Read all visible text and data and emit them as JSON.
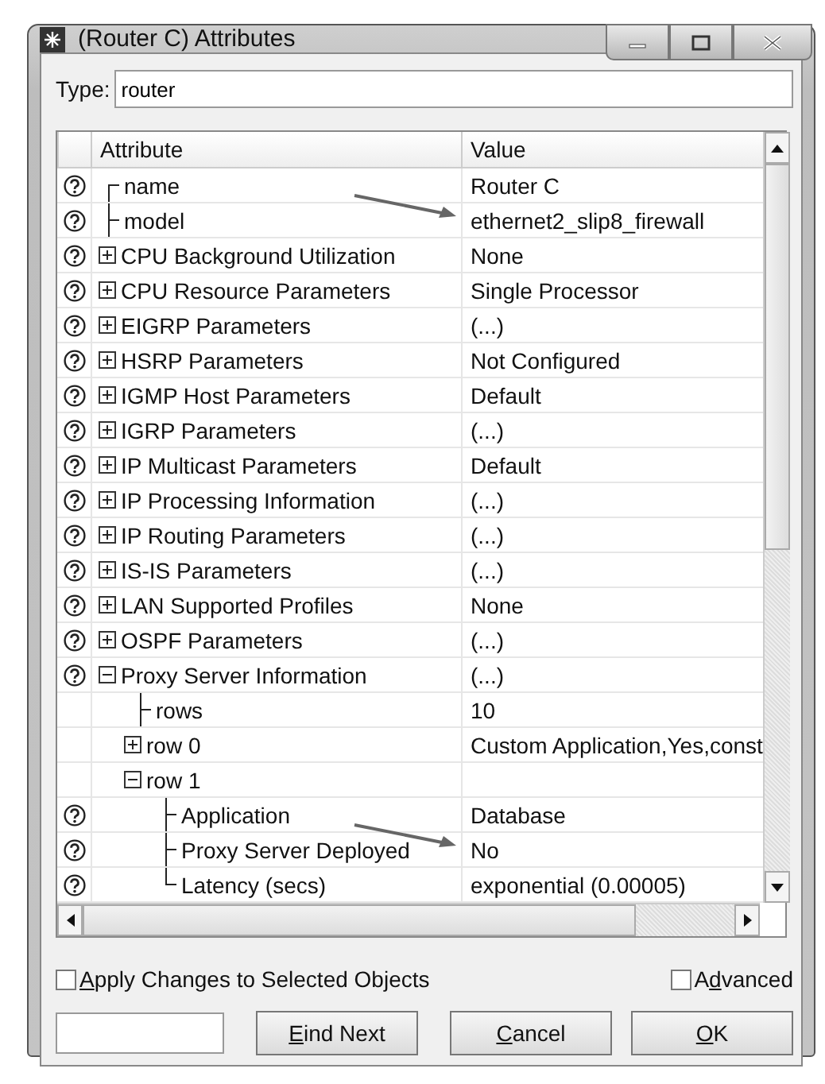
{
  "window": {
    "title": "(Router C) Attributes"
  },
  "type_field": {
    "label": "Type:",
    "value": "router"
  },
  "table": {
    "columns": [
      "Attribute",
      "Value"
    ],
    "rows": [
      {
        "attribute": "name",
        "value": "Router C",
        "help": true,
        "kind": "first"
      },
      {
        "attribute": "model",
        "value": "ethernet2_slip8_firewall",
        "help": true,
        "kind": "middle"
      },
      {
        "attribute": "CPU Background Utilization",
        "value": "None",
        "help": true,
        "expanded": false
      },
      {
        "attribute": "CPU Resource Parameters",
        "value": "Single Processor",
        "help": true,
        "expanded": false
      },
      {
        "attribute": "EIGRP Parameters",
        "value": "(...)",
        "help": true,
        "expanded": false
      },
      {
        "attribute": "HSRP Parameters",
        "value": "Not Configured",
        "help": true,
        "expanded": false
      },
      {
        "attribute": "IGMP Host Parameters",
        "value": "Default",
        "help": true,
        "expanded": false
      },
      {
        "attribute": "IGRP Parameters",
        "value": "(...)",
        "help": true,
        "expanded": false
      },
      {
        "attribute": "IP Multicast Parameters",
        "value": "Default",
        "help": true,
        "expanded": false
      },
      {
        "attribute": "IP Processing Information",
        "value": "(...)",
        "help": true,
        "expanded": false
      },
      {
        "attribute": "IP Routing Parameters",
        "value": "(...)",
        "help": true,
        "expanded": false
      },
      {
        "attribute": "IS-IS Parameters",
        "value": "(...)",
        "help": true,
        "expanded": false
      },
      {
        "attribute": "LAN Supported Profiles",
        "value": "None",
        "help": true,
        "expanded": false
      },
      {
        "attribute": "OSPF Parameters",
        "value": "(...)",
        "help": true,
        "expanded": false
      },
      {
        "attribute": "Proxy Server Information",
        "value": "(...)",
        "help": true,
        "expanded": true,
        "children": [
          {
            "attribute": "rows",
            "value": "10",
            "help": false,
            "kind": "middle"
          },
          {
            "attribute": "row 0",
            "value": "Custom Application,Yes,const",
            "help": false,
            "expanded": false
          },
          {
            "attribute": "row 1",
            "help": false,
            "expanded": true,
            "children": [
              {
                "attribute": "Application",
                "value": "Database",
                "help": true,
                "kind": "middle"
              },
              {
                "attribute": "Proxy Server Deployed",
                "value": "No",
                "help": true,
                "kind": "middle"
              },
              {
                "attribute": "Latency (secs)",
                "value": "exponential (0.00005)",
                "help": true,
                "kind": "last"
              }
            ]
          }
        ]
      }
    ]
  },
  "options": [
    {
      "key": "A",
      "post": "pply Changes to Selected Objects",
      "checked": false
    },
    {
      "pre": "A",
      "key": "d",
      "post": "vanced",
      "checked": false
    }
  ],
  "buttons": [
    {
      "key": "E",
      "post": "ind Next"
    },
    {
      "key": "C",
      "post": "ancel"
    },
    {
      "key": "O",
      "post": "K"
    }
  ]
}
